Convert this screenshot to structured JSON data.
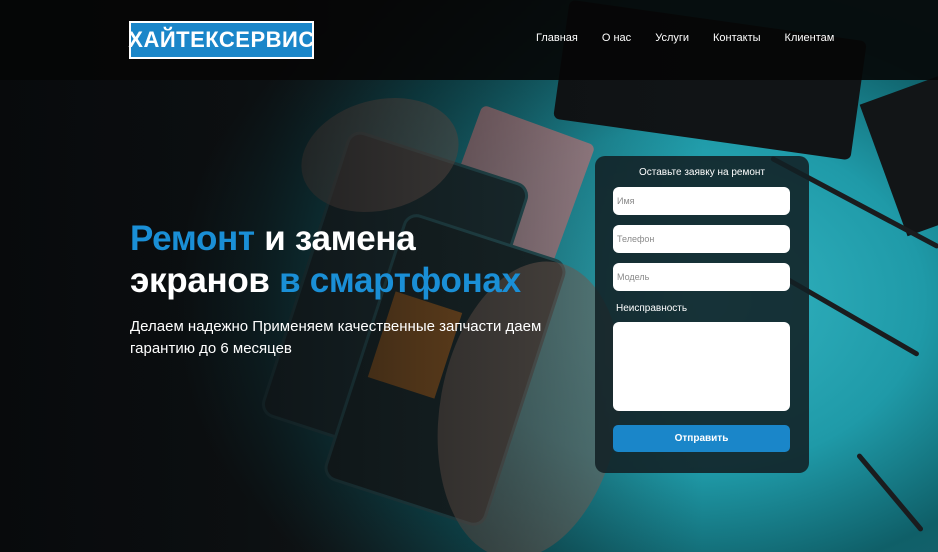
{
  "header": {
    "logo_text": "ХАЙТЕКСЕРВИС",
    "nav": [
      {
        "label": "Главная"
      },
      {
        "label": "О нас"
      },
      {
        "label": "Услуги"
      },
      {
        "label": "Контакты"
      },
      {
        "label": "Клиентам"
      }
    ]
  },
  "hero": {
    "title_part1": "Ремонт",
    "title_part2": " и замена",
    "title_part3": "экранов ",
    "title_part4": "в смартфонах",
    "subtitle": "Делаем надежно Применяем качественные запчасти даем гарантию до 6 месяцев"
  },
  "form": {
    "title": "Оставьте заявку на ремонт",
    "name_placeholder": "Имя",
    "phone_placeholder": "Телефон",
    "model_placeholder": "Модель",
    "issue_label": "Неисправность",
    "submit_label": "Отправить"
  },
  "colors": {
    "accent": "#1a8fd6",
    "header_bg": "#050505",
    "button": "#1a86c9"
  }
}
